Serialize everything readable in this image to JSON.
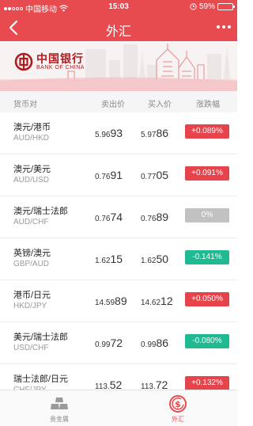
{
  "status_bar": {
    "carrier": "中国移动",
    "time": "15:03",
    "battery": "59%",
    "battery_level": 0.59
  },
  "nav": {
    "title": "外汇"
  },
  "header": {
    "pair": "货币对",
    "sell": "卖出价",
    "buy": "买入价",
    "change": "涨跌幅"
  },
  "colors": {
    "brand": "#e74a4f",
    "up": "#e7434b",
    "down": "#1fb992",
    "flat": "#c2c2c2"
  },
  "rows": [
    {
      "pair": "澳元/港币",
      "code": "AUD/HKD",
      "sell_pre": "5.96",
      "sell_big": "93",
      "buy_pre": "5.97",
      "buy_big": "86",
      "change": "+0.089%",
      "dir": "up"
    },
    {
      "pair": "澳元/美元",
      "code": "AUD/USD",
      "sell_pre": "0.76",
      "sell_big": "91",
      "buy_pre": "0.77",
      "buy_big": "05",
      "change": "+0.091%",
      "dir": "up"
    },
    {
      "pair": "澳元/瑞士法郎",
      "code": "AUD/CHF",
      "sell_pre": "0.76",
      "sell_big": "74",
      "buy_pre": "0.76",
      "buy_big": "89",
      "change": "0%",
      "dir": "flat"
    },
    {
      "pair": "英镑/澳元",
      "code": "GBP/AUD",
      "sell_pre": "1.62",
      "sell_big": "15",
      "buy_pre": "1.62",
      "buy_big": "50",
      "change": "-0.141%",
      "dir": "down"
    },
    {
      "pair": "港币/日元",
      "code": "HKD/JPY",
      "sell_pre": "14.59",
      "sell_big": "89",
      "buy_pre": "14.62",
      "buy_big": "12",
      "change": "+0.050%",
      "dir": "up"
    },
    {
      "pair": "美元/瑞士法郎",
      "code": "USD/CHF",
      "sell_pre": "0.99",
      "sell_big": "72",
      "buy_pre": "0.99",
      "buy_big": "86",
      "change": "-0.080%",
      "dir": "down"
    },
    {
      "pair": "瑞士法郎/日元",
      "code": "CHF/JPY",
      "sell_pre": "113.",
      "sell_big": "52",
      "buy_pre": "113.",
      "buy_big": "72",
      "change": "+0.132%",
      "dir": "up"
    }
  ],
  "tabs": [
    {
      "label": "贵金属",
      "icon": "gold-bars-icon",
      "active": false
    },
    {
      "label": "外汇",
      "icon": "forex-exchange-icon",
      "active": true
    }
  ],
  "banner": {
    "bank_cn": "中国银行",
    "bank_en": "BANK OF CHINA",
    "logo_icon": "bank-of-china-logo-icon",
    "skyline": "city-skyline-illustration"
  }
}
